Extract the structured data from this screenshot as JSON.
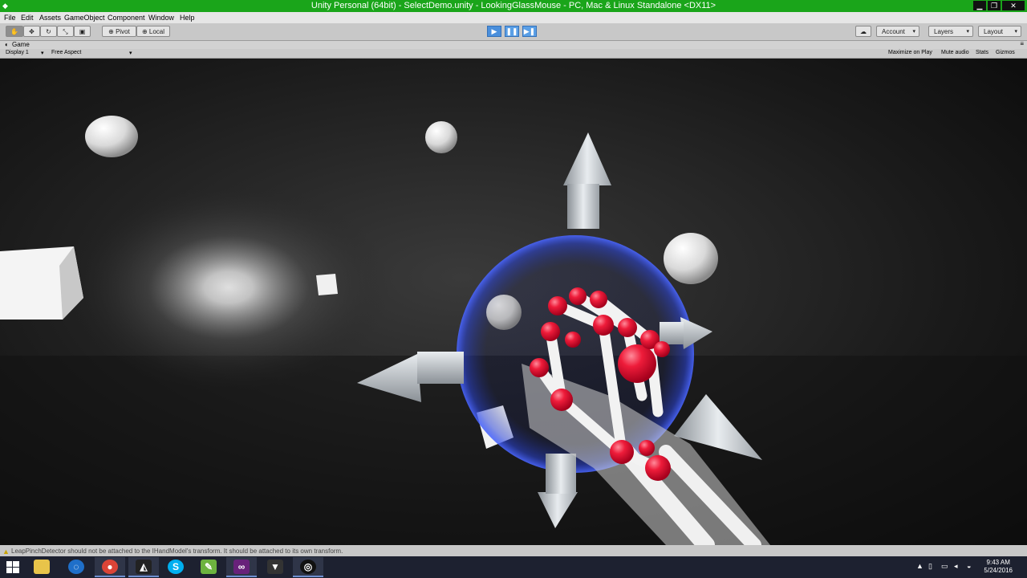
{
  "window": {
    "title": "Unity Personal (64bit) - SelectDemo.unity - LookingGlassMouse - PC, Mac & Linux Standalone <DX11>",
    "controls": [
      "minimize-icon",
      "restore-icon",
      "close-icon"
    ]
  },
  "menu": [
    "File",
    "Edit",
    "Assets",
    "GameObject",
    "Component",
    "Window",
    "Help"
  ],
  "toolbar": {
    "pivot": "Pivot",
    "local": "Local",
    "account": "Account",
    "layers": "Layers",
    "layout": "Layout"
  },
  "game": {
    "tab": "Game",
    "display": "Display 1",
    "aspect": "Free Aspect",
    "buttons": [
      "Maximize on Play",
      "Mute audio",
      "Stats",
      "Gizmos"
    ]
  },
  "status": {
    "message": "LeapPinchDetector should not be attached to the IHandModel's transform. It should be attached to its own transform."
  },
  "taskbar": {
    "time": "9:43 AM",
    "date": "5/24/2016"
  }
}
